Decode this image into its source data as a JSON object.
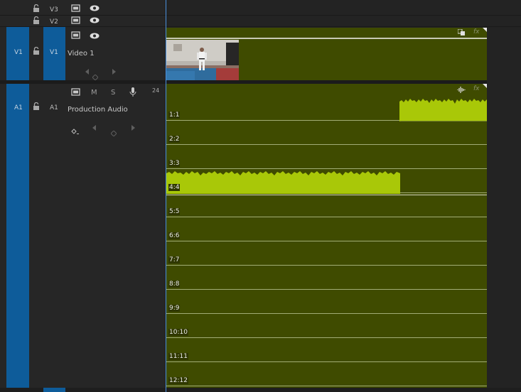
{
  "tracks": {
    "v3": {
      "label": "V3"
    },
    "v2": {
      "label": "V2"
    },
    "v1": {
      "source_label": "V1",
      "target_label": "V1",
      "name": "Video 1"
    },
    "a1": {
      "source_label": "A1",
      "target_label": "A1",
      "name": "Production Audio",
      "meter_value": "24"
    }
  },
  "audio_controls": {
    "mute": "M",
    "solo": "S"
  },
  "clip_badges": {
    "fx": "fx"
  },
  "channels": [
    "1:1",
    "2:2",
    "3:3",
    "4:4",
    "5:5",
    "6:6",
    "7:7",
    "8:8",
    "9:9",
    "10:10",
    "11:11",
    "12:12"
  ],
  "colors": {
    "clip_bg": "#3f4b00",
    "waveform": "#a9c808",
    "track_target": "#0e5c9a",
    "playhead": "#4a8fdc"
  },
  "icons": [
    "lock-icon",
    "film-icon",
    "eye-icon",
    "keyframe-prev-icon",
    "keyframe-add-icon",
    "keyframe-next-icon",
    "microphone-icon",
    "fx-badge",
    "waveform-icon"
  ]
}
